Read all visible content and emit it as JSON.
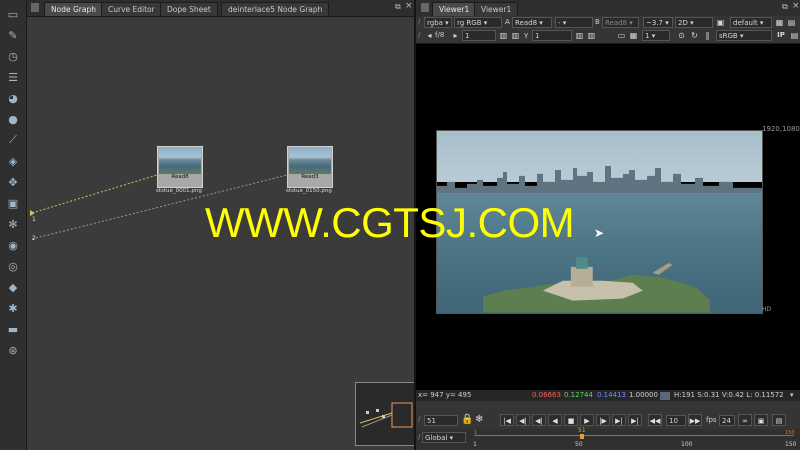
{
  "toolbar": {
    "tools": [
      "image-icon",
      "paint-brush-icon",
      "clock-icon",
      "channel-icon",
      "color-wheel-icon",
      "sphere-icon",
      "curves-icon",
      "layers-icon",
      "transform-icon",
      "3d-cube-icon",
      "particles-icon",
      "deep-icon",
      "views-icon",
      "tag-icon",
      "tools-icon",
      "other-icon",
      "nuke-logo-icon"
    ]
  },
  "node_graph": {
    "tabs": [
      "Node Graph",
      "Curve Editor",
      "Dope Sheet",
      "deinterlace5 Node Graph"
    ],
    "nodes": [
      {
        "label": "Read8",
        "file": "ststue_0001.png"
      },
      {
        "label": "Read3",
        "file": "ststue_0150.png"
      }
    ],
    "pipe_labels": [
      "1",
      "2"
    ]
  },
  "viewer": {
    "tabs": [
      "Viewer1",
      "Viewer1"
    ],
    "row1": {
      "channels": "rgba",
      "rgb": "rg RGB",
      "a_label": "A",
      "a_input": "Read8",
      "a_op": "-",
      "b_label": "B",
      "b_input": "Read8",
      "zoom": "~3.7",
      "mode": "2D",
      "preset": "default"
    },
    "row2": {
      "fstop": "f/8",
      "gain": "1",
      "gamma_label": "γ",
      "gamma": "1",
      "proxy": "1",
      "lut": "sRGB",
      "ip": "IP"
    },
    "frame_size": "1920,1080",
    "format": "HD",
    "info": {
      "coords": "x= 947 y= 495",
      "r": "0.06663",
      "g": "0.12744",
      "b": "0.14413",
      "a": "1.00000",
      "hsvl": "H:191 S:0.31 V:0.42  L: 0.11572"
    },
    "colors": {
      "r": "#ff5a5a",
      "g": "#5fd35f",
      "b": "#6f8cff"
    }
  },
  "playback": {
    "frame": "51",
    "increment": "10",
    "fps_label": "fps",
    "fps": "24",
    "scope": "Global",
    "ticks": [
      "1",
      "50",
      "100",
      "150"
    ],
    "in_marker": "1",
    "current_marker": "51",
    "out_marker": "150"
  },
  "watermark": "WWW.CGTSJ.COM"
}
